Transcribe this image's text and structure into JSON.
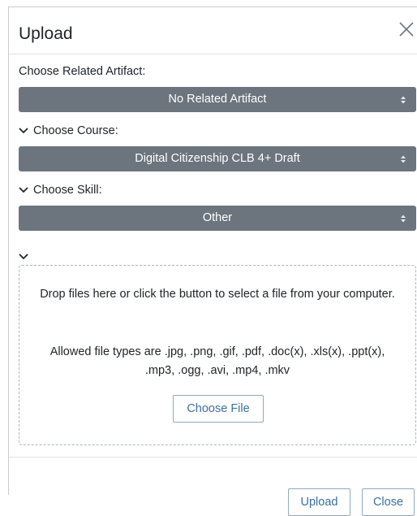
{
  "modal": {
    "title": "Upload",
    "close_icon": "close-icon"
  },
  "fields": {
    "artifact": {
      "label": "Choose Related Artifact:",
      "value": "No Related Artifact"
    },
    "course": {
      "label": "Choose Course:",
      "value": "Digital Citizenship CLB 4+ Draft"
    },
    "skill": {
      "label": "Choose Skill:",
      "value": "Other"
    }
  },
  "dropzone": {
    "instructions": "Drop files here or click the button to select a file from your computer.",
    "allowed_types": "Allowed file types are .jpg, .png, .gif, .pdf, .doc(x), .xls(x), .ppt(x), .mp3, .ogg, .avi, .mp4, .mkv",
    "choose_label": "Choose File"
  },
  "footer": {
    "upload_label": "Upload",
    "close_label": "Close"
  },
  "colors": {
    "select_bg": "#6c757d",
    "button_text": "#3b6fa3"
  }
}
